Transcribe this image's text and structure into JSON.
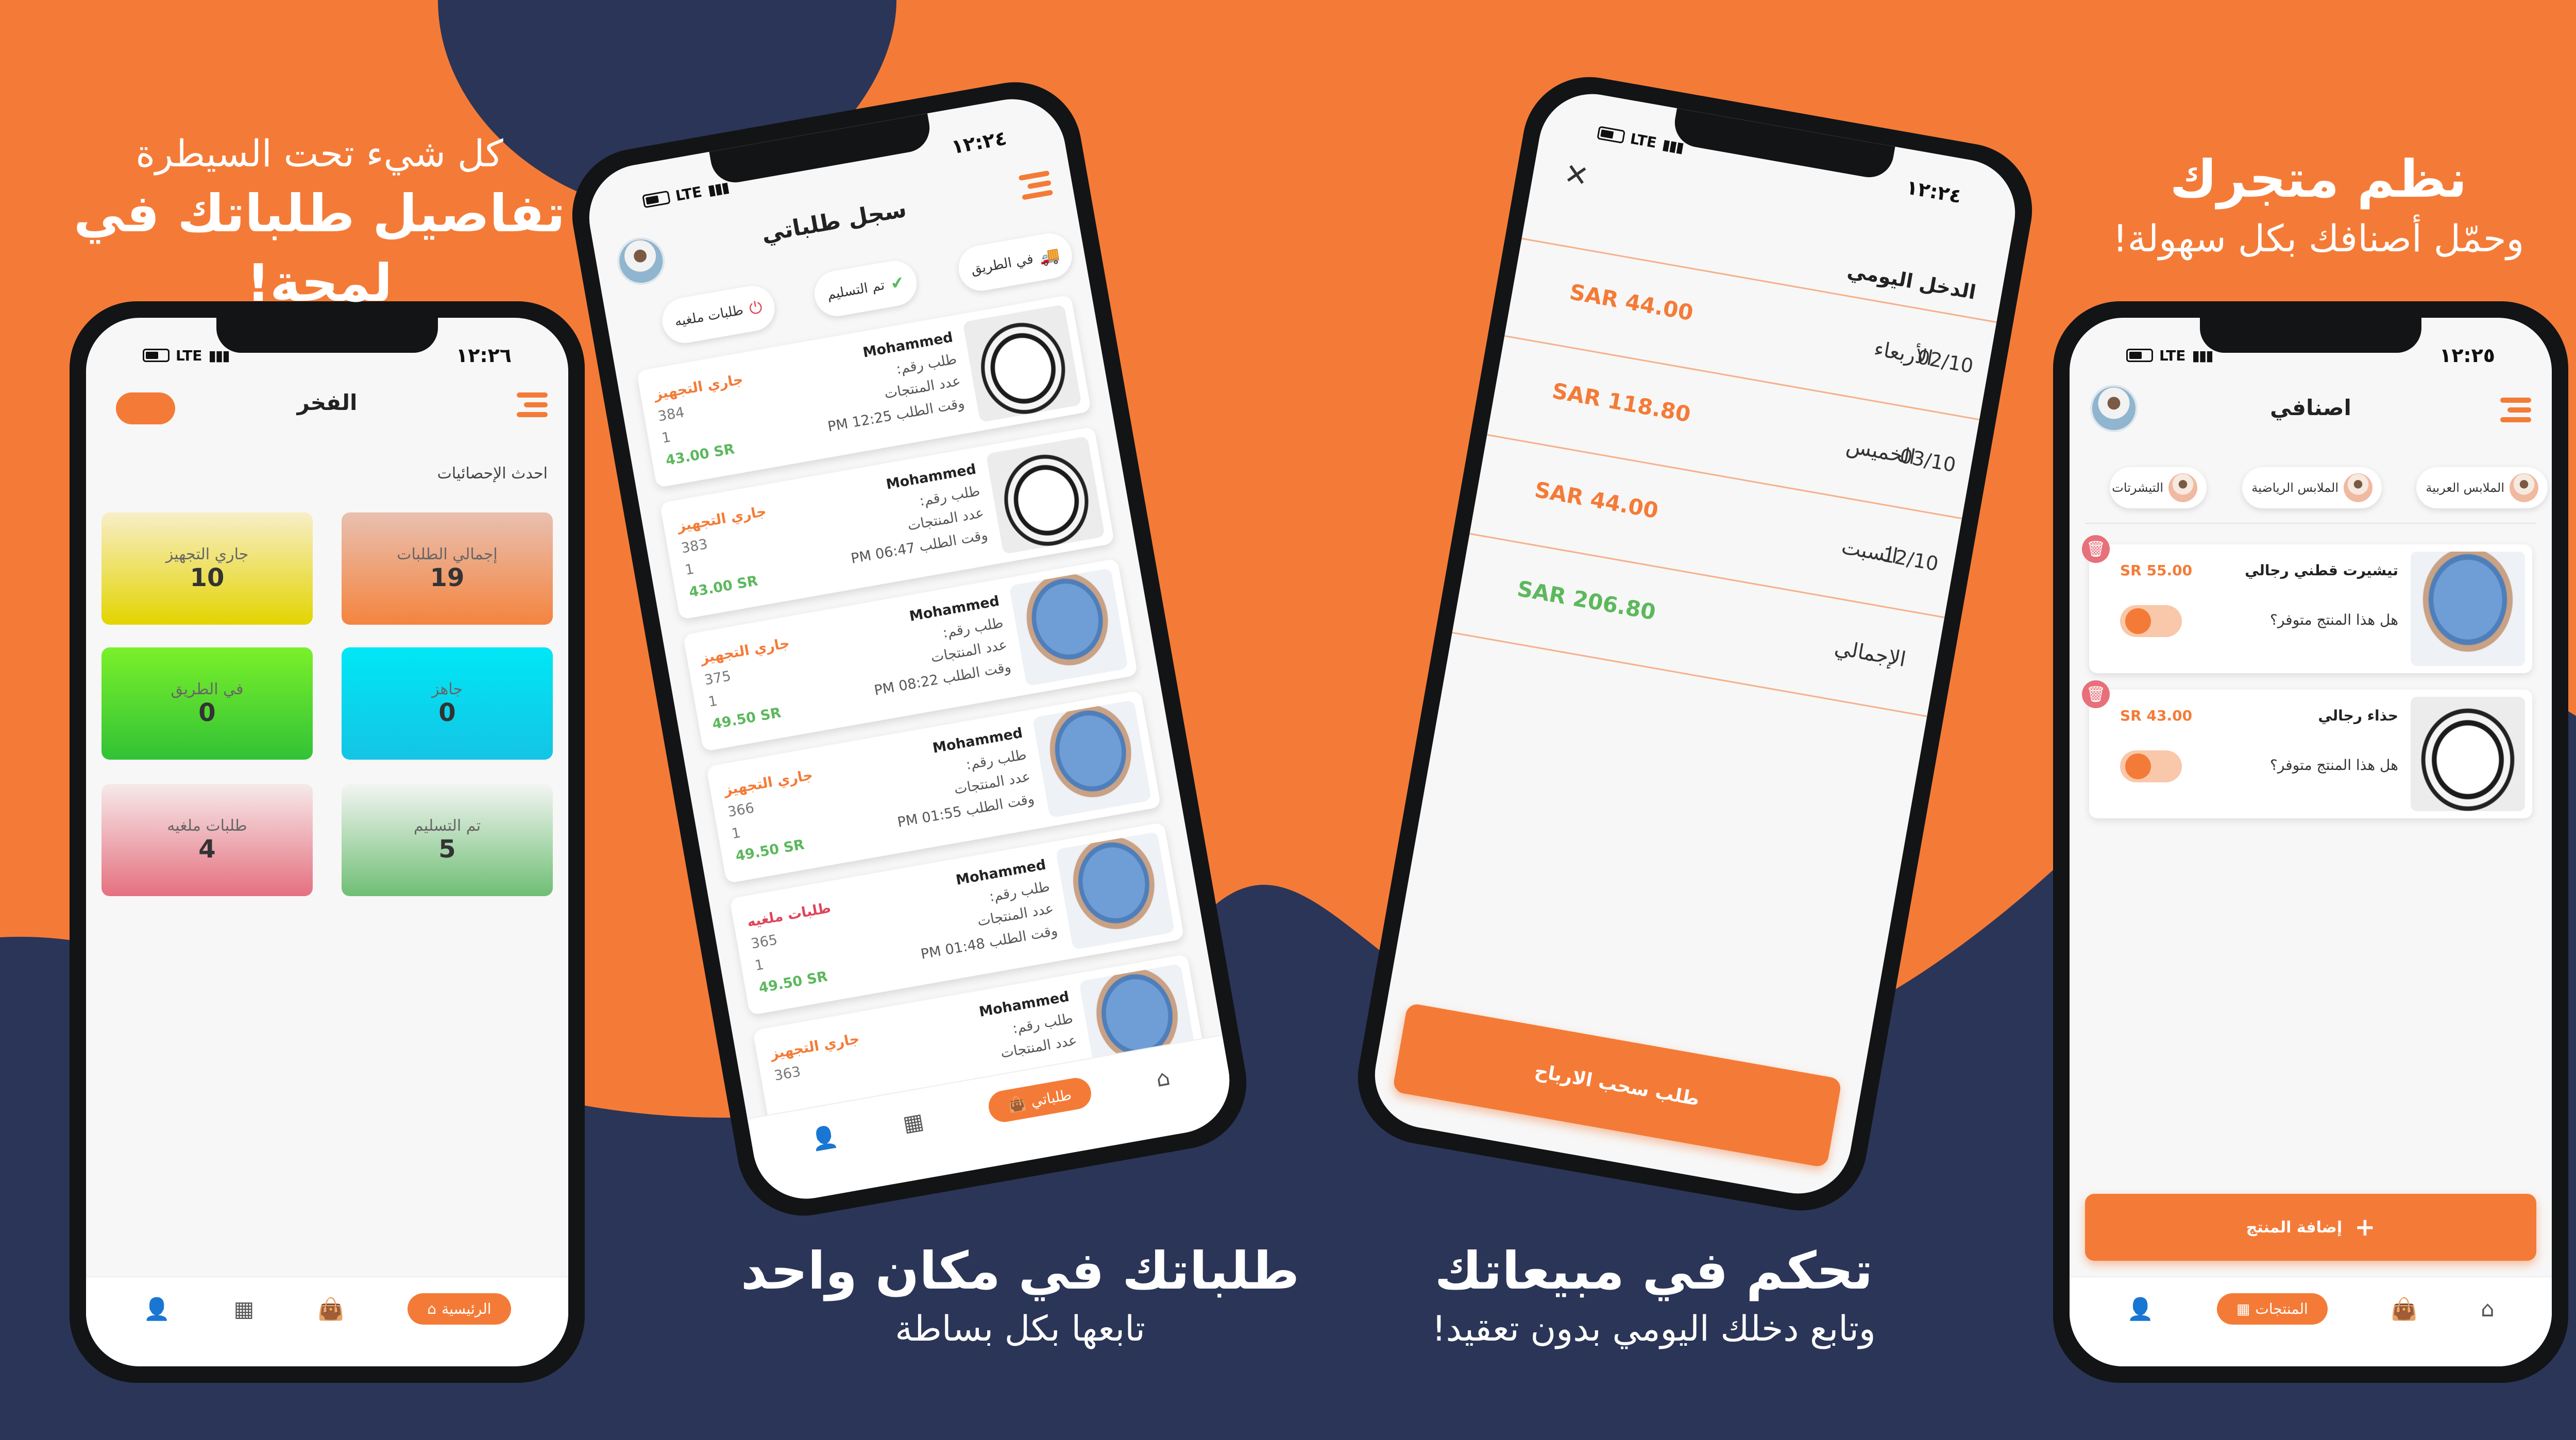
{
  "colors": {
    "accent": "#f47b37",
    "navy": "#2b3557",
    "green": "#5cb85c",
    "cancel": "#e0445a"
  },
  "sections": [
    {
      "title": "تفاصيل طلباتك في لمحة!",
      "subtitle": "كل شيء تحت السيطرة"
    },
    {
      "title": "طلباتك في مكان واحد",
      "subtitle": "تابعها بكل بساطة"
    },
    {
      "title": "تحكم في مبيعاتك",
      "subtitle": "وتابع دخلك اليومي بدون تعقيد!"
    },
    {
      "title": "نظم متجرك",
      "subtitle": "وحمّل أصنافك بكل سهولة!"
    }
  ],
  "phone1": {
    "time": "١٢:٢٦",
    "lte": "LTE",
    "store_name": "الفخر",
    "stats_title": "احدث الإحصائيات",
    "cards": [
      {
        "label": "إجمالي الطلبات",
        "value": "19"
      },
      {
        "label": "جاري التجهيز",
        "value": "10"
      },
      {
        "label": "جاهز",
        "value": "0"
      },
      {
        "label": "في الطريق",
        "value": "0"
      },
      {
        "label": "تم التسليم",
        "value": "5"
      },
      {
        "label": "طلبات ملغيه",
        "value": "4"
      }
    ],
    "nav_home": "الرئيسية"
  },
  "phone2": {
    "time": "١٢:٢٤",
    "lte": "LTE",
    "title": "سجل طلباتي",
    "filters": [
      "في الطريق",
      "تم التسليم",
      "طلبات ملغيه"
    ],
    "order_no_label": "طلب رقم:",
    "count_label": "عدد المنتجات",
    "time_label": "وقت الطلب",
    "orders": [
      {
        "name": "Mohammed",
        "status": "جاري التجهيز",
        "num": "384",
        "count": "1",
        "time": "PM 12:25",
        "price": "43.00 SR",
        "img": "shoe",
        "cancelled": false
      },
      {
        "name": "Mohammed",
        "status": "جاري التجهيز",
        "num": "383",
        "count": "1",
        "time": "PM 06:47",
        "price": "43.00 SR",
        "img": "shoe",
        "cancelled": false
      },
      {
        "name": "Mohammed",
        "status": "جاري التجهيز",
        "num": "375",
        "count": "1",
        "time": "PM 08:22",
        "price": "49.50 SR",
        "img": "tee",
        "cancelled": false
      },
      {
        "name": "Mohammed",
        "status": "جاري التجهيز",
        "num": "366",
        "count": "1",
        "time": "PM 01:55",
        "price": "49.50 SR",
        "img": "tee",
        "cancelled": false
      },
      {
        "name": "Mohammed",
        "status": "طلبات ملغيه",
        "num": "365",
        "count": "1",
        "time": "PM 01:48",
        "price": "49.50 SR",
        "img": "tee",
        "cancelled": true
      },
      {
        "name": "Mohammed",
        "status": "جاري التجهيز",
        "num": "363",
        "count": "",
        "time": "",
        "price": "",
        "img": "tee",
        "cancelled": false
      }
    ],
    "nav_orders": "طلباتي"
  },
  "phone3": {
    "time": "١٢:٢٤",
    "lte": "LTE",
    "title": "الدخل اليومي",
    "rows": [
      {
        "day": "الأربعاء",
        "date": "02/10",
        "amount": "44.00 SAR"
      },
      {
        "day": "الخميس",
        "date": "03/10",
        "amount": "118.80 SAR"
      },
      {
        "day": "السبت",
        "date": "12/10",
        "amount": "44.00 SAR"
      }
    ],
    "total_label": "الإجمالي",
    "total_amount": "206.80 SAR",
    "withdraw_button": "طلب سحب الارباح"
  },
  "phone4": {
    "time": "١٢:٢٥",
    "lte": "LTE",
    "title": "اصنافي",
    "categories": [
      "الملابس العربية",
      "الملابس الرياضية",
      "التيشرتات"
    ],
    "products": [
      {
        "name": "تيشيرت قطني رجالي",
        "price": "55.00 SR",
        "question": "هل هذا المنتج متوفر؟",
        "img": "tee"
      },
      {
        "name": "حذاء رجالي",
        "price": "43.00 SR",
        "question": "هل هذا المنتج متوفر؟",
        "img": "shoe"
      }
    ],
    "add_button": "إضافة المنتج",
    "nav_products": "المنتجات"
  }
}
